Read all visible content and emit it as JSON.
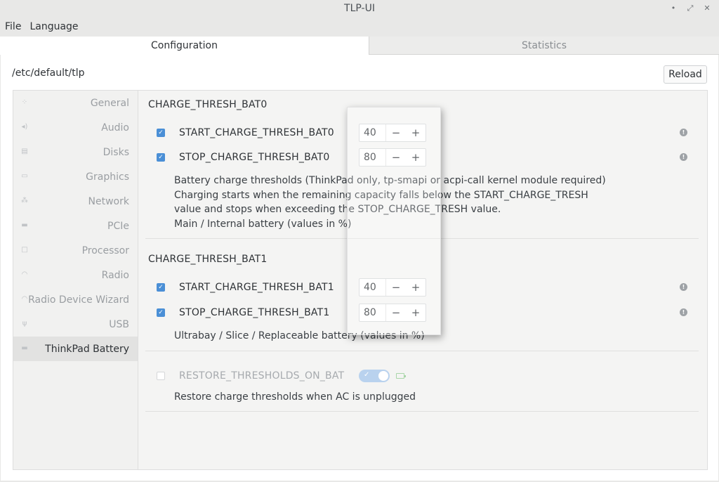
{
  "window": {
    "title": "TLP-UI"
  },
  "menu": {
    "file": "File",
    "language": "Language"
  },
  "tabs": {
    "configuration": "Configuration",
    "statistics": "Statistics"
  },
  "config_path": "/etc/default/tlp",
  "reload_label": "Reload",
  "sidebar": {
    "items": [
      {
        "label": "General"
      },
      {
        "label": "Audio"
      },
      {
        "label": "Disks"
      },
      {
        "label": "Graphics"
      },
      {
        "label": "Network"
      },
      {
        "label": "PCIe"
      },
      {
        "label": "Processor"
      },
      {
        "label": "Radio"
      },
      {
        "label": "Radio Device Wizard"
      },
      {
        "label": "USB"
      },
      {
        "label": "ThinkPad Battery"
      }
    ],
    "active": "ThinkPad Battery"
  },
  "bat0": {
    "heading": "CHARGE_THRESH_BAT0",
    "start_label": "START_CHARGE_THRESH_BAT0",
    "start_value": "40",
    "stop_label": "STOP_CHARGE_THRESH_BAT0",
    "stop_value": "80",
    "desc": [
      "Battery charge thresholds (ThinkPad only, tp-smapi or acpi-call kernel module required)",
      "Charging starts when the remaining capacity falls below the START_CHARGE_TRESH",
      "value and stops when exceeding the STOP_CHARGE_TRESH value.",
      "Main / Internal battery (values in %)"
    ]
  },
  "bat1": {
    "heading": "CHARGE_THRESH_BAT1",
    "start_label": "START_CHARGE_THRESH_BAT1",
    "start_value": "40",
    "stop_label": "STOP_CHARGE_THRESH_BAT1",
    "stop_value": "80",
    "desc": "Ultrabay / Slice / Replaceable battery (values in %)"
  },
  "restore": {
    "label": "RESTORE_THRESHOLDS_ON_BAT",
    "desc": "Restore charge thresholds when AC is unplugged",
    "enabled": false,
    "toggle_on": true
  },
  "spin": {
    "minus": "−",
    "plus": "+"
  },
  "colors": {
    "accent": "#4a8fd6",
    "toggle": "#b9d2ee",
    "battery_icon": "#a9d6a9"
  }
}
